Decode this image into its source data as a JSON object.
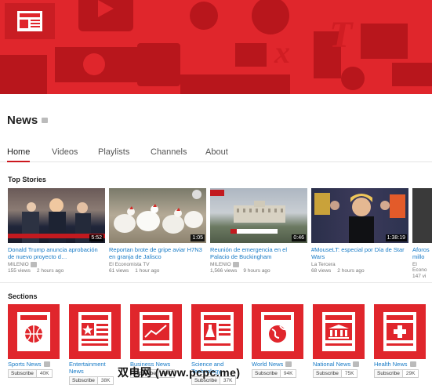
{
  "channel": {
    "name": "News"
  },
  "tabs": [
    {
      "label": "Home"
    },
    {
      "label": "Videos"
    },
    {
      "label": "Playlists"
    },
    {
      "label": "Channels"
    },
    {
      "label": "About"
    }
  ],
  "top_stories": {
    "title": "Top Stories",
    "videos": [
      {
        "title": "Donald Trump anuncia aprobación de nuevo proyecto d…",
        "channel": "MILENIO",
        "views": "155 views",
        "age": "2 hours ago",
        "duration": "5:52"
      },
      {
        "title": "Reportan brote de gripe aviar H7N3 en granja de Jalisco",
        "channel": "El Economista TV",
        "views": "61 views",
        "age": "1 hour ago",
        "duration": "1:05"
      },
      {
        "title": "Reunión de emergencia en el Palacio de Buckingham",
        "channel": "MILENIO",
        "views": "1,566 views",
        "age": "9 hours ago",
        "duration": "0:46"
      },
      {
        "title": "#MouseLT: especial por Día de Star Wars",
        "channel": "La Tercera",
        "views": "68 views",
        "age": "2 hours ago",
        "duration": "1:38:19"
      },
      {
        "title": "Aforos millo",
        "channel": "El Econo",
        "views": "147 vi",
        "age": "",
        "duration": ""
      }
    ]
  },
  "sections": {
    "title": "Sections",
    "items": [
      {
        "name": "Sports News",
        "count": "40K",
        "icon": "basketball-icon"
      },
      {
        "name": "Entertainment News",
        "count": "38K",
        "icon": "star-icon"
      },
      {
        "name": "Business News",
        "count": "40K",
        "icon": "chart-icon"
      },
      {
        "name": "Science and Technology",
        "count": "37K",
        "icon": "flask-icon"
      },
      {
        "name": "World News",
        "count": "94K",
        "icon": "globe-icon"
      },
      {
        "name": "National News",
        "count": "75K",
        "icon": "building-icon"
      },
      {
        "name": "Health News",
        "count": "29K",
        "icon": "cross-icon"
      }
    ],
    "subscribe_label": "Subscribe"
  },
  "watermark": "双电网 (www.pcpc.me)",
  "colors": {
    "brand": "#e0262c",
    "link": "#167ac6"
  }
}
